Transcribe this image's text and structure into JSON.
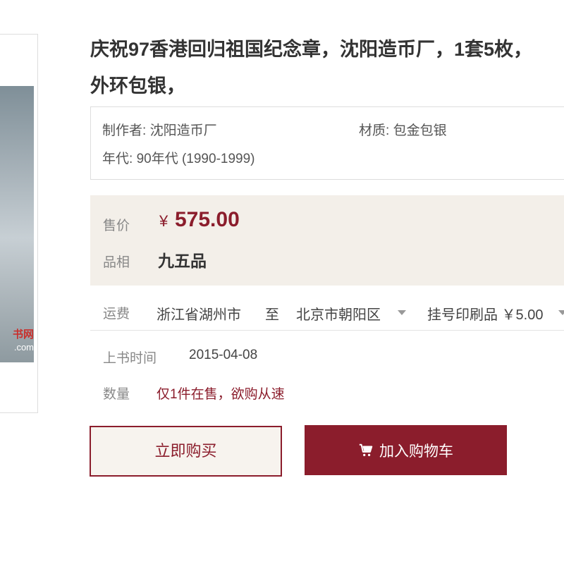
{
  "product": {
    "title_line1": "庆祝97香港回归祖国纪念章，沈阳造币厂，1套5枚，",
    "title_line2": "外环包银，"
  },
  "image": {
    "watermark_text": "书网",
    "watermark_url": ".com"
  },
  "attributes": {
    "maker_label": "制作者:",
    "maker_value": "沈阳造币厂",
    "material_label": "材质:",
    "material_value": "包金包银",
    "era_label": "年代:",
    "era_value": "90年代 (1990-1999)"
  },
  "pricing": {
    "price_label": "售价",
    "currency": "¥",
    "price": "575.00",
    "condition_label": "品相",
    "condition_value": "九五品"
  },
  "shipping": {
    "label": "运费",
    "from": "浙江省湖州市",
    "to_word": "至",
    "destination": "北京市朝阳区",
    "method": "挂号印刷品 ￥5.00"
  },
  "listing": {
    "date_label": "上书时间",
    "date_value": "2015-04-08",
    "qty_label": "数量",
    "qty_value": "仅1件在售，欲购从速"
  },
  "buttons": {
    "buy_now": "立即购买",
    "add_to_cart": "加入购物车"
  },
  "colors": {
    "accent": "#8b1d2c",
    "price_bg": "#f3efe9"
  },
  "icons": {
    "cart": "shopping-cart-icon",
    "dropdown": "triangle-down-icon"
  }
}
